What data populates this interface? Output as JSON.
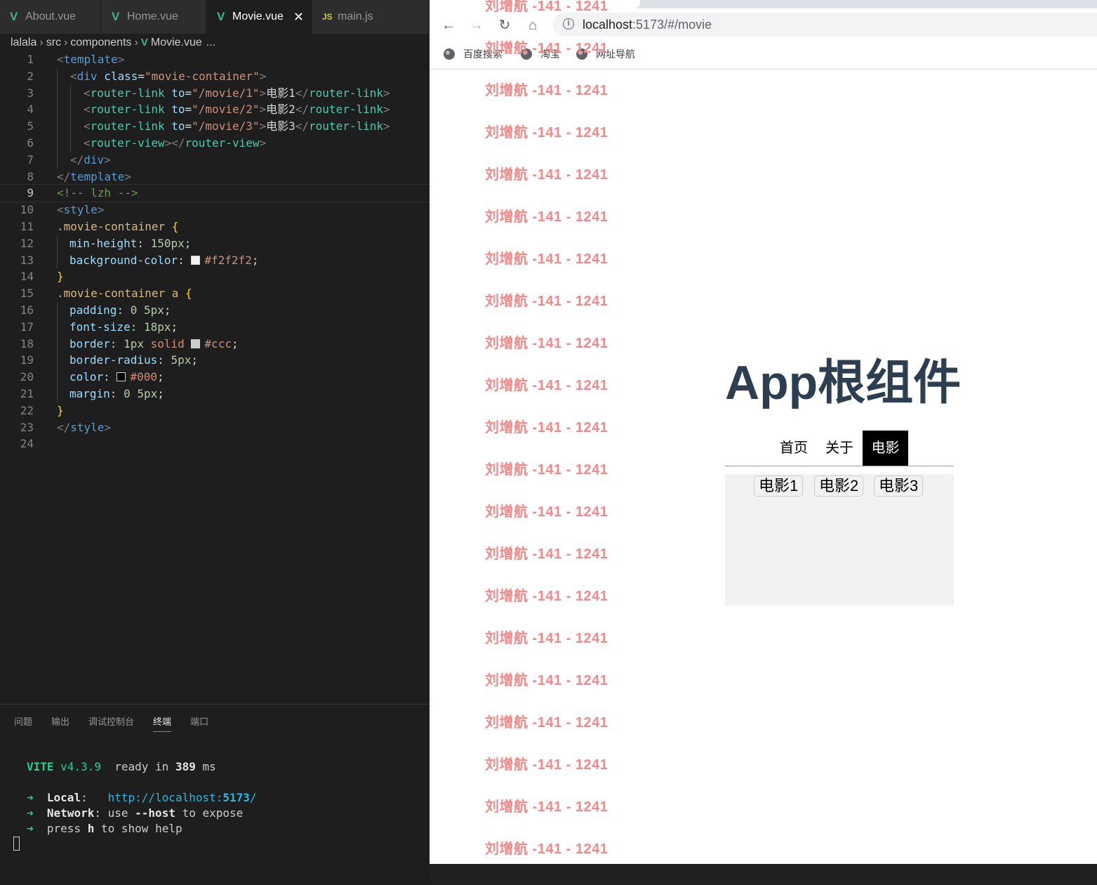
{
  "editor": {
    "tabs": [
      {
        "label": "About.vue",
        "icon": "vue-icon"
      },
      {
        "label": "Home.vue",
        "icon": "vue-icon"
      },
      {
        "label": "Movie.vue",
        "icon": "vue-icon",
        "active": true
      },
      {
        "label": "main.js",
        "icon": "js-icon"
      }
    ],
    "breadcrumb": [
      "lalala",
      "src",
      "components",
      "Movie.vue",
      "..."
    ],
    "line_numbers": [
      "1",
      "2",
      "3",
      "4",
      "5",
      "6",
      "7",
      "8",
      "9",
      "10",
      "11",
      "12",
      "13",
      "14",
      "15",
      "16",
      "17",
      "18",
      "19",
      "20",
      "21",
      "22",
      "23",
      "24"
    ],
    "code": {
      "l1_tag": "template",
      "l2_tag": "div",
      "l2_attr": "class",
      "l2_val": "\"movie-container\"",
      "rl_tag": "router-link",
      "rl_attr": "to",
      "l3_val": "\"/movie/1\"",
      "l3_text": "电影1",
      "l4_val": "\"/movie/2\"",
      "l4_text": "电影2",
      "l5_val": "\"/movie/3\"",
      "l5_text": "电影3",
      "l6_tag": "router-view",
      "l7_tag": "div",
      "l8_tag": "template",
      "l9_comment": "<!-- lzh -->",
      "l10_tag": "style",
      "l11_sel": ".movie-container",
      "l12_prop": "min-height",
      "l12_val": "150px",
      "l13_prop": "background-color",
      "l13_val": "#f2f2f2",
      "l15_sel": ".movie-container a",
      "l16_prop": "padding",
      "l16_val": "0 5px",
      "l17_prop": "font-size",
      "l17_val": "18px",
      "l18_prop": "border",
      "l18_val_a": "1px",
      "l18_val_b": "solid",
      "l18_val_c": "#ccc",
      "l19_prop": "border-radius",
      "l19_val": "5px",
      "l20_prop": "color",
      "l20_val": "#000",
      "l21_prop": "margin",
      "l21_val": "0 5px",
      "l23_tag": "style"
    },
    "swatch_colors": {
      "bg": "#f2f2f2",
      "border": "#ccc",
      "color": "#000"
    },
    "panel_tabs": [
      "问题",
      "输出",
      "调试控制台",
      "终端",
      "端口"
    ],
    "terminal": {
      "vite": "VITE",
      "version": "v4.3.9",
      "ready": "ready in",
      "ms_num": "389",
      "ms": "ms",
      "arrow": "➜",
      "local_label": "Local",
      "local_url_a": "http://localhost:",
      "local_url_port": "5173",
      "local_url_b": "/",
      "network_label": "Network",
      "network_a": "use",
      "network_b": "--host",
      "network_c": "to expose",
      "help_a": "press",
      "help_b": "h",
      "help_c": "to show help"
    }
  },
  "browser": {
    "url_host": "localhost",
    "url_rest": ":5173/#/movie",
    "bookmarks": [
      "百度搜索",
      "淘宝",
      "网址导航"
    ],
    "watermark_text": "刘增航 -141 - 1241",
    "app_title": "App根组件",
    "nav": [
      "首页",
      "关于",
      "电影"
    ],
    "movie_links": [
      "电影1",
      "电影2",
      "电影3"
    ]
  }
}
